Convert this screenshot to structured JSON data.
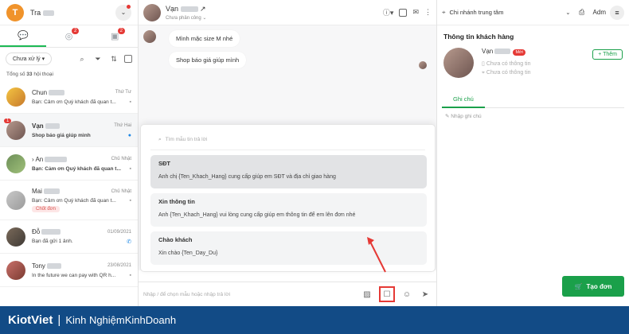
{
  "colors": {
    "brand_green": "#1aa04a",
    "banner_blue": "#124b86",
    "alert_red": "#e53935"
  },
  "left": {
    "user": {
      "initial": "T",
      "name": "Tra"
    },
    "tabs": [
      {
        "icon": "chat-icon",
        "badge": ""
      },
      {
        "icon": "messenger-icon",
        "badge": "2"
      },
      {
        "icon": "comment-icon",
        "badge": "2"
      }
    ],
    "filter": {
      "status_select": "Chưa xử lý"
    },
    "total": {
      "prefix": "Tổng số ",
      "count": "33",
      "suffix": " hội thoại"
    },
    "conversations": [
      {
        "name": "Chun",
        "date": "Thứ Tư",
        "msg": "Bạn: Cảm ơn Quý khách đã quan t...",
        "tag": "",
        "unread": ""
      },
      {
        "name": "Vạn",
        "date": "Thứ Hai",
        "msg": "Shop báo giá giúp mình",
        "tag": "",
        "unread": "1"
      },
      {
        "name": "An",
        "date": "Chủ Nhật",
        "msg": "Bạn: Cảm ơn Quý khách đã quan t...",
        "tag": "",
        "unread": ""
      },
      {
        "name": "Mai",
        "date": "Chủ Nhật",
        "msg": "Bạn: Cảm ơn Quý khách đã quan t...",
        "tag": "Chốt đơn",
        "unread": ""
      },
      {
        "name": "Đỗ",
        "date": "01/09/2021",
        "msg": "Bạn đã gửi 1 ảnh.",
        "tag": "",
        "unread": ""
      },
      {
        "name": "Tony",
        "date": "23/08/2021",
        "msg": "In the future we can pay with QR h...",
        "tag": "",
        "unread": ""
      }
    ]
  },
  "chat": {
    "header": {
      "name": "Vạn",
      "subtitle": "Chưa phân công"
    },
    "messages": [
      "Mình mặc size M nhé",
      "Shop báo giá giúp mình"
    ],
    "templates": {
      "search_placeholder": "Tìm mẫu tin trả lời",
      "items": [
        {
          "title": "SĐT",
          "content": "Anh chị {Ten_Khach_Hang} cung cấp giúp em SĐT và địa chỉ giao hàng"
        },
        {
          "title": "Xin thông tin",
          "content": "Anh {Ten_Khach_Hang} vui lòng cung cấp giúp em thông tin để em lên đơn nhé"
        },
        {
          "title": "Chào khách",
          "content": "Xin chào {Ten_Day_Du}"
        }
      ]
    },
    "compose_placeholder": "Nhập / để chọn mẫu hoặc nhập trả lời"
  },
  "right": {
    "branch": "Chi nhánh trung tâm",
    "admin": "Adm",
    "customer_info_title": "Thông tin khách hàng",
    "customer": {
      "name": "Vạn",
      "new_badge": "Mới",
      "phone": "Chưa có thông tin",
      "address": "Chưa có thông tin"
    },
    "add_button": "+ Thêm",
    "notes_tab": "Ghi chú",
    "note_placeholder": "Nhập ghi chú",
    "create_order": "Tạo đơn"
  },
  "banner": {
    "brand": "KiotViet",
    "separator": "|",
    "tagline": "Kinh NghiệmKinhDoanh"
  }
}
